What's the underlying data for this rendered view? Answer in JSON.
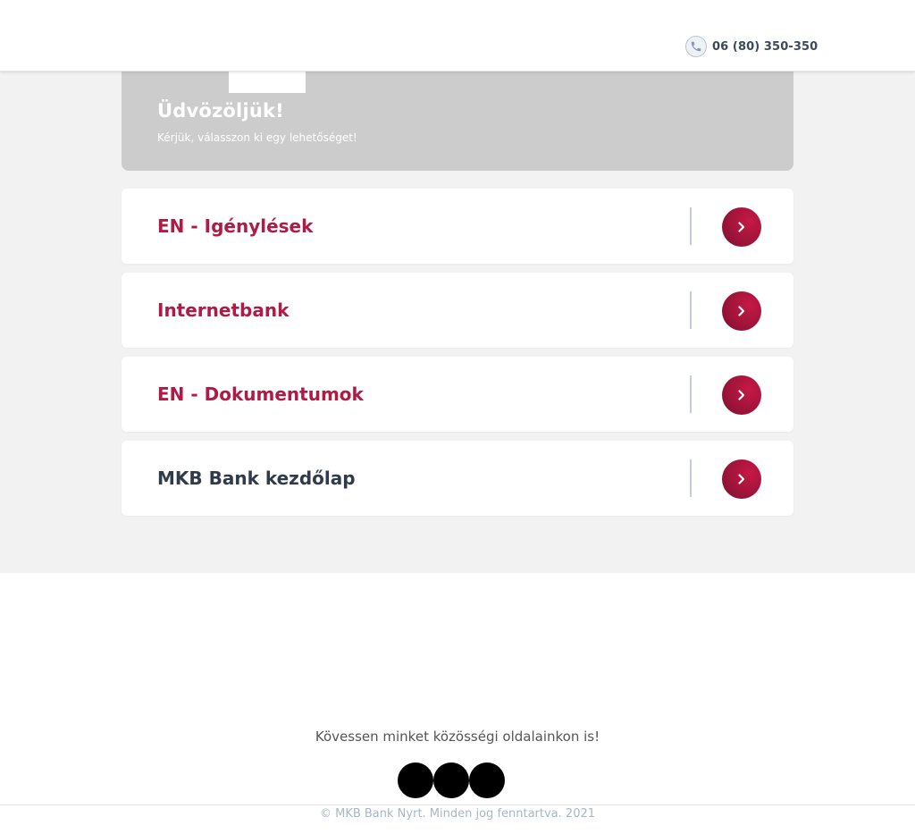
{
  "header": {
    "phone": "06 (80) 350-350",
    "phone_icon": "phone-icon"
  },
  "banner": {
    "title": "Üdvözöljük!",
    "subtitle": "Kérjük, válasszon ki egy lehetőséget!"
  },
  "menu": {
    "items": [
      {
        "label": "EN - Igénylések",
        "color": "#b01b45"
      },
      {
        "label": "Internetbank",
        "color": "#b01b45"
      },
      {
        "label": "EN - Dokumentumok",
        "color": "#b01b45"
      },
      {
        "label": "MKB Bank kezdőlap",
        "color": "#2f3b4c"
      }
    ],
    "arrow_icon": "chevron-right-icon"
  },
  "footer": {
    "follow_text": "Kövessen minket közösségi oldalainkon is!",
    "social_icons": [
      "social-icon-1",
      "social-icon-2",
      "social-icon-3"
    ],
    "copyright": "© MKB Bank Nyrt. Minden jog fenntartva. 2021"
  },
  "colors": {
    "accent": "#b01b45",
    "banner_bg": "#cccccc",
    "page_bg": "#f2f2f2"
  }
}
